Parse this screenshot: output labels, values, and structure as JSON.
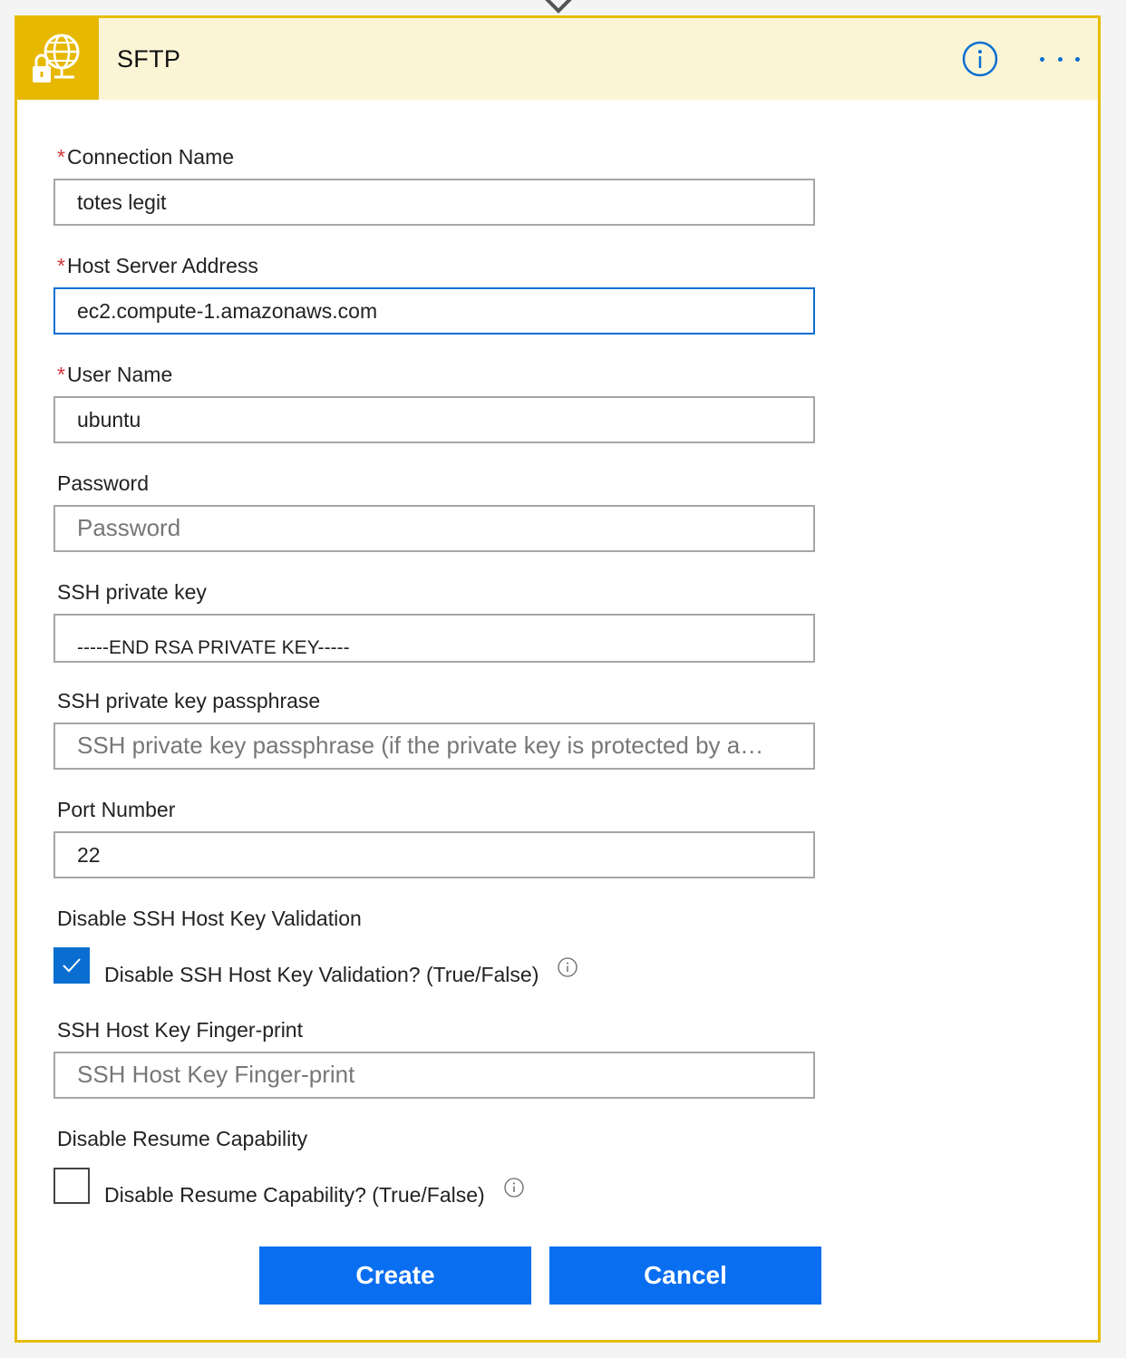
{
  "header": {
    "title": "SFTP",
    "service_icon": "globe-lock-icon",
    "info_icon": "info-icon",
    "more_icon": "more-dots-icon"
  },
  "fields": {
    "connection_name": {
      "label": "Connection Name",
      "required": "*",
      "value": "totes legit"
    },
    "host_server_address": {
      "label": "Host Server Address",
      "required": "*",
      "value": "ec2.compute-1.amazonaws.com"
    },
    "user_name": {
      "label": "User Name",
      "required": "*",
      "value": "ubuntu"
    },
    "password": {
      "label": "Password",
      "placeholder": "Password",
      "value": ""
    },
    "ssh_private_key": {
      "label": "SSH private key",
      "value": "-----END RSA PRIVATE KEY-----"
    },
    "ssh_private_key_passphrase": {
      "label": "SSH private key passphrase",
      "placeholder": "SSH private key passphrase (if the private key is protected by a…",
      "value": ""
    },
    "port_number": {
      "label": "Port Number",
      "value": "22"
    },
    "disable_host_key_validation": {
      "label": "Disable SSH Host Key Validation",
      "checkbox_label": "Disable SSH Host Key Validation? (True/False)",
      "checked": true
    },
    "host_key_fingerprint": {
      "label": "SSH Host Key Finger-print",
      "placeholder": "SSH Host Key Finger-print",
      "value": ""
    },
    "disable_resume": {
      "label": "Disable Resume Capability",
      "checkbox_label": "Disable Resume Capability? (True/False)",
      "checked": false
    }
  },
  "buttons": {
    "create": "Create",
    "cancel": "Cancel"
  },
  "colors": {
    "accent_border": "#e6bc00",
    "header_bg": "#fbf5d6",
    "primary_blue": "#0a6ef0",
    "required_red": "#d13438"
  }
}
